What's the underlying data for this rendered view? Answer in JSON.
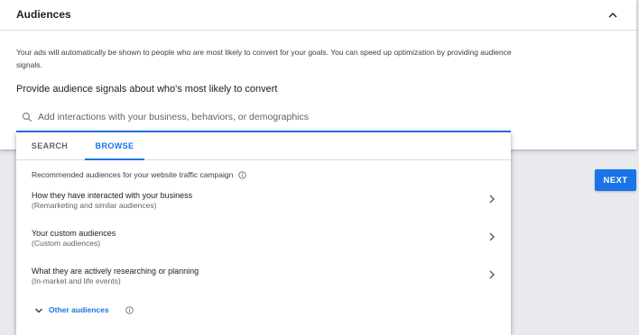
{
  "card": {
    "title": "Audiences",
    "description": "Your ads will automatically be shown to people who are most likely to convert for your goals. You can speed up optimization by providing audience signals.",
    "prompt": "Provide audience signals about who's most likely to convert"
  },
  "search": {
    "placeholder": "Add interactions with your business, behaviors, or demographics",
    "value": ""
  },
  "tabs": [
    {
      "label": "SEARCH",
      "active": false
    },
    {
      "label": "BROWSE",
      "active": true
    }
  ],
  "browse": {
    "section_label": "Recommended audiences for your website traffic campaign",
    "items": [
      {
        "title": "How they have interacted with your business",
        "subtitle": "(Remarketing and similar audiences)"
      },
      {
        "title": "Your custom audiences",
        "subtitle": "(Custom audiences)"
      },
      {
        "title": "What they are actively researching or planning",
        "subtitle": "(In-market and life events)"
      }
    ],
    "other_label": "Other audiences"
  },
  "actions": {
    "next_label": "NEXT"
  },
  "icons": {
    "collapse": "chevron-up-icon",
    "search": "search-icon",
    "info": "info-icon",
    "item_chevron": "chevron-right-icon",
    "other_chevron": "chevron-down-icon"
  },
  "colors": {
    "accent": "#1a73e8",
    "page_background": "#e8eaed",
    "card_background": "#ffffff",
    "text_primary": "#202124",
    "text_secondary": "#5f6368",
    "divider": "#dadce0"
  }
}
